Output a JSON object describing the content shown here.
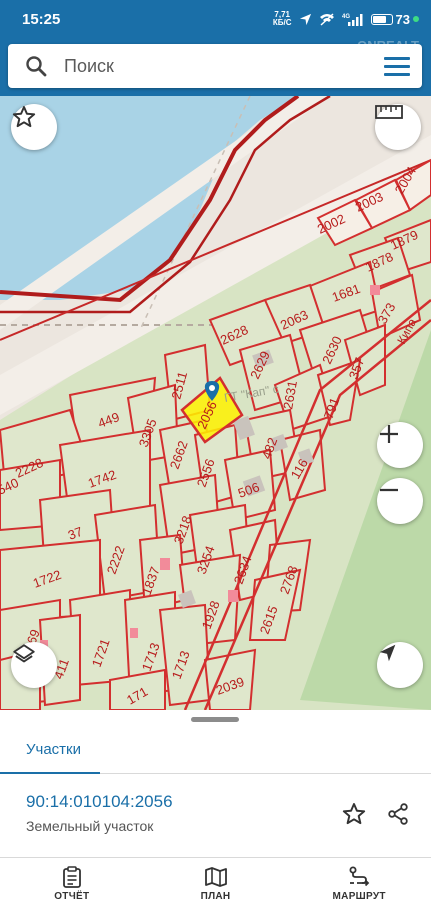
{
  "status_bar": {
    "time": "15:25",
    "net_speed_value": "7,71",
    "net_speed_unit": "КБ/С",
    "network_type": "4G",
    "battery_percent": "73",
    "battery_level": 0.73
  },
  "header": {
    "search_placeholder": "Поиск",
    "watermark": "ONREALT"
  },
  "map": {
    "buttons": {
      "favorite": "star-icon",
      "ruler": "ruler-icon",
      "zoom_in": "plus-icon",
      "zoom_out": "minus-icon",
      "layers": "layers-icon",
      "location": "location-arrow-icon"
    },
    "street_label": "Кипа",
    "selected_parcel_label": "2056",
    "selected_parcel_extra": "ГТ \"Кап\" с",
    "parcel_labels": [
      "2002",
      "2003",
      "2004",
      "1879",
      "1878",
      "1681",
      "2063",
      "373",
      "2628",
      "2630",
      "2629",
      "357",
      "2511",
      "2631",
      "791",
      "449",
      "3305",
      "482",
      "2662",
      "2556",
      "116",
      "2228",
      "1742",
      "506",
      "540",
      "37",
      "3218",
      "2222",
      "3254",
      "1837",
      "2634",
      "2768",
      "1722",
      "1928",
      "2615",
      "69",
      "1721",
      "1713",
      "411",
      "1713",
      "2039",
      "171"
    ]
  },
  "sheet": {
    "tab_label": "Участки",
    "parcel_number": "90:14:010104:2056",
    "parcel_type": "Земельный участок"
  },
  "bottom_nav": {
    "report": "ОТЧЁТ",
    "plan": "ПЛАН",
    "route": "МАРШРУТ"
  },
  "colors": {
    "brand": "#1a6fa8",
    "parcel_border": "#d32f2f",
    "selected_parcel_fill": "#fff200",
    "water": "#a9d3e6"
  }
}
